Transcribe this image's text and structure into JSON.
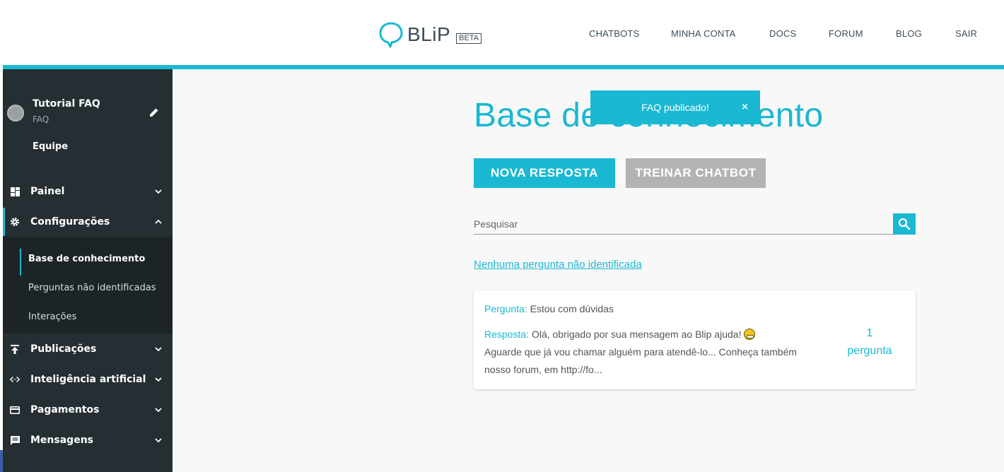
{
  "header": {
    "logo_text": "BLiP",
    "logo_badge": "BETA",
    "nav": [
      "CHATBOTS",
      "MINHA CONTA",
      "DOCS",
      "FORUM",
      "BLOG",
      "SAIR"
    ]
  },
  "sidebar": {
    "bot_name": "Tutorial FAQ",
    "bot_subtitle": "FAQ",
    "team_label": "Equipe",
    "menu": [
      {
        "label": "Painel",
        "icon": "dashboard-icon"
      },
      {
        "label": "Configurações",
        "icon": "gear-icon"
      },
      {
        "label": "Publicações",
        "icon": "upload-icon"
      },
      {
        "label": "Inteligência artificial",
        "icon": "code-icon"
      },
      {
        "label": "Pagamentos",
        "icon": "credit-card-icon"
      },
      {
        "label": "Mensagens",
        "icon": "message-icon"
      }
    ],
    "submenu": [
      "Base de conhecimento",
      "Perguntas não identificadas",
      "Interações"
    ]
  },
  "main": {
    "title": "Base de conhecimento",
    "toast": {
      "text": "FAQ publicado!",
      "close": "×"
    },
    "new_button": "NOVA RESPOSTA",
    "train_button": "TREINAR CHATBOT",
    "search_placeholder": "Pesquisar",
    "unidentified_link": "Nenhuma pergunta não identificada",
    "faq": {
      "question_label": "Pergunta:",
      "question": "Estou com dúvidas",
      "answer_label": "Resposta:",
      "answer_part1": "Olá, obrigado por sua mensagem ao Blip ajuda!",
      "answer_part2": "Aguarde que já vou chamar alguém para atendê-lo... Conheça também nosso forum, em http://fo...",
      "count": "1",
      "count_label": "pergunta"
    }
  },
  "colors": {
    "accent": "#1ab8d2",
    "sidebar": "#252f33",
    "submenu": "#1c2427",
    "disabled": "#b3b3b3"
  }
}
